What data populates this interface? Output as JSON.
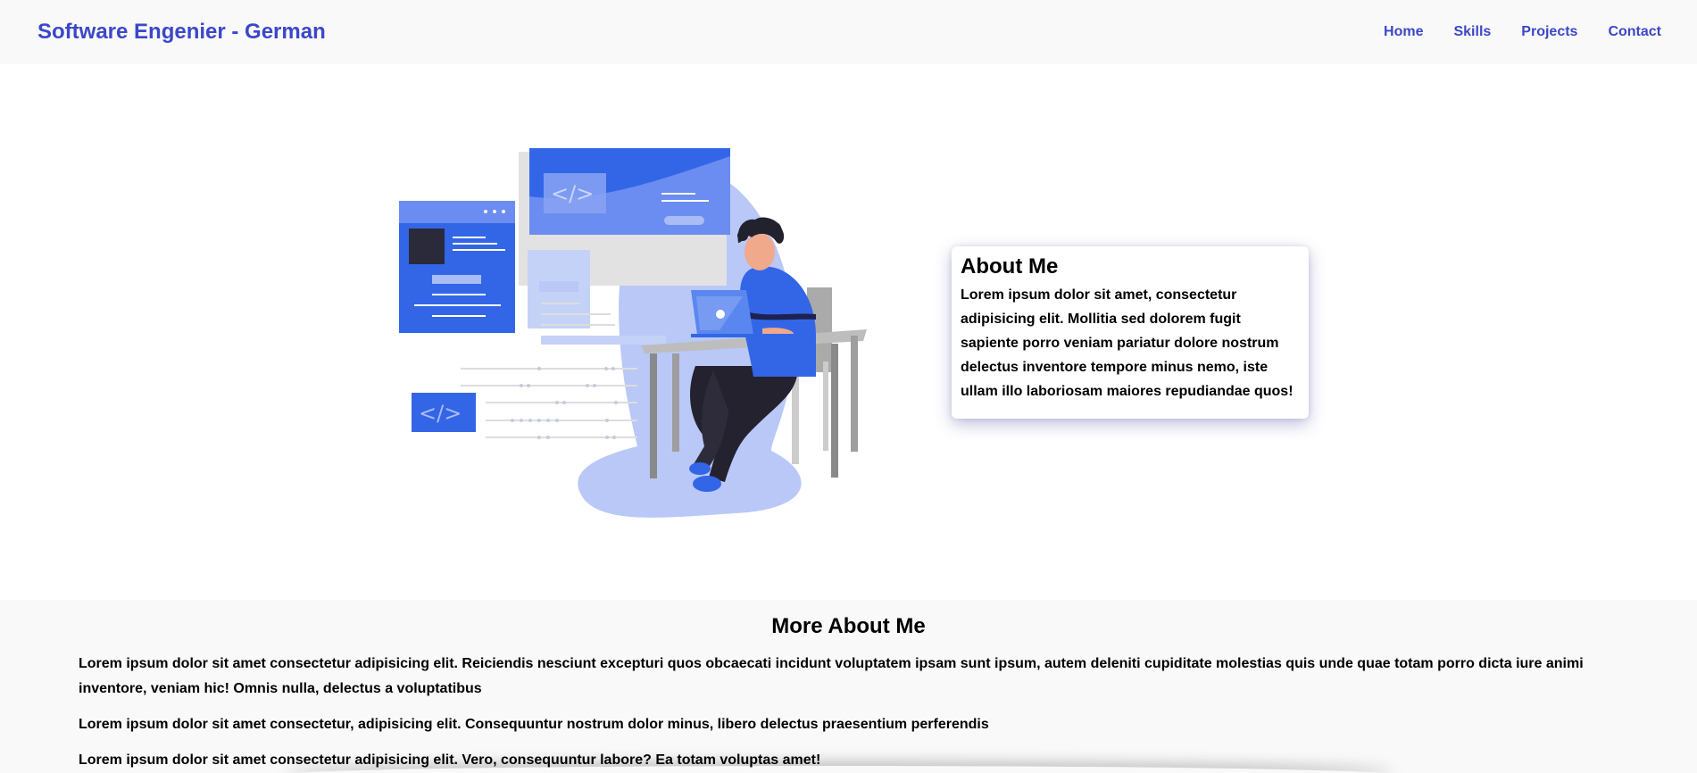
{
  "navbar": {
    "brand": "Software Engenier - German",
    "links": [
      "Home",
      "Skills",
      "Projects",
      "Contact"
    ]
  },
  "about": {
    "title": "About Me",
    "text": "Lorem ipsum dolor sit amet, consectetur adipisicing elit. Mollitia sed dolorem fugit sapiente porro veniam pariatur dolore nostrum delectus inventore tempore minus nemo, iste ullam illo laboriosam maiores repudiandae quos!"
  },
  "more": {
    "title": "More About Me",
    "paragraphs": [
      "Lorem ipsum dolor sit amet consectetur adipisicing elit. Reiciendis nesciunt excepturi quos obcaecati incidunt voluptatem ipsam sunt ipsum, autem deleniti cupiditate molestias quis unde quae totam porro dicta iure animi inventore, veniam hic! Omnis nulla, delectus a voluptatibus",
      "Lorem ipsum dolor sit amet consectetur, adipisicing elit. Consequuntur nostrum dolor minus, libero delectus praesentium perferendis",
      "Lorem ipsum dolor sit amet consectetur adipisicing elit. Vero, consequuntur labore? Ea totam voluptas amet!"
    ]
  },
  "colors": {
    "accent": "#3b47c9",
    "illustration_blue": "#3366e6",
    "illustration_light": "#b9c8f7"
  },
  "icons": [
    "code-icon",
    "developer-illustration"
  ]
}
